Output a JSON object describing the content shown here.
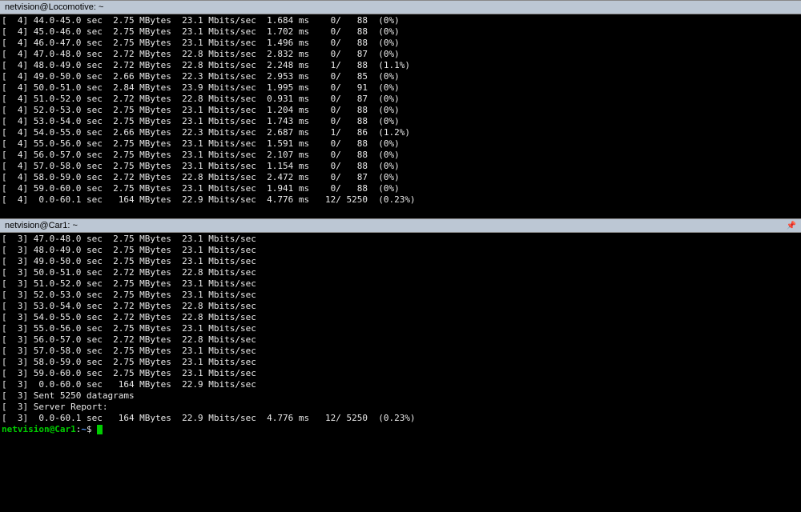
{
  "top": {
    "title": "netvision@Locomotive: ~",
    "rows": [
      [
        "[  4]",
        "44.0-45.0 sec",
        "2.75 MBytes",
        "23.1 Mbits/sec",
        "1.684 ms",
        "0/",
        "88",
        "(0%)"
      ],
      [
        "[  4]",
        "45.0-46.0 sec",
        "2.75 MBytes",
        "23.1 Mbits/sec",
        "1.702 ms",
        "0/",
        "88",
        "(0%)"
      ],
      [
        "[  4]",
        "46.0-47.0 sec",
        "2.75 MBytes",
        "23.1 Mbits/sec",
        "1.496 ms",
        "0/",
        "88",
        "(0%)"
      ],
      [
        "[  4]",
        "47.0-48.0 sec",
        "2.72 MBytes",
        "22.8 Mbits/sec",
        "2.832 ms",
        "0/",
        "87",
        "(0%)"
      ],
      [
        "[  4]",
        "48.0-49.0 sec",
        "2.72 MBytes",
        "22.8 Mbits/sec",
        "2.248 ms",
        "1/",
        "88",
        "(1.1%)"
      ],
      [
        "[  4]",
        "49.0-50.0 sec",
        "2.66 MBytes",
        "22.3 Mbits/sec",
        "2.953 ms",
        "0/",
        "85",
        "(0%)"
      ],
      [
        "[  4]",
        "50.0-51.0 sec",
        "2.84 MBytes",
        "23.9 Mbits/sec",
        "1.995 ms",
        "0/",
        "91",
        "(0%)"
      ],
      [
        "[  4]",
        "51.0-52.0 sec",
        "2.72 MBytes",
        "22.8 Mbits/sec",
        "0.931 ms",
        "0/",
        "87",
        "(0%)"
      ],
      [
        "[  4]",
        "52.0-53.0 sec",
        "2.75 MBytes",
        "23.1 Mbits/sec",
        "1.204 ms",
        "0/",
        "88",
        "(0%)"
      ],
      [
        "[  4]",
        "53.0-54.0 sec",
        "2.75 MBytes",
        "23.1 Mbits/sec",
        "1.743 ms",
        "0/",
        "88",
        "(0%)"
      ],
      [
        "[  4]",
        "54.0-55.0 sec",
        "2.66 MBytes",
        "22.3 Mbits/sec",
        "2.687 ms",
        "1/",
        "86",
        "(1.2%)"
      ],
      [
        "[  4]",
        "55.0-56.0 sec",
        "2.75 MBytes",
        "23.1 Mbits/sec",
        "1.591 ms",
        "0/",
        "88",
        "(0%)"
      ],
      [
        "[  4]",
        "56.0-57.0 sec",
        "2.75 MBytes",
        "23.1 Mbits/sec",
        "2.107 ms",
        "0/",
        "88",
        "(0%)"
      ],
      [
        "[  4]",
        "57.0-58.0 sec",
        "2.75 MBytes",
        "23.1 Mbits/sec",
        "1.154 ms",
        "0/",
        "88",
        "(0%)"
      ],
      [
        "[  4]",
        "58.0-59.0 sec",
        "2.72 MBytes",
        "22.8 Mbits/sec",
        "2.472 ms",
        "0/",
        "87",
        "(0%)"
      ],
      [
        "[  4]",
        "59.0-60.0 sec",
        "2.75 MBytes",
        "23.1 Mbits/sec",
        "1.941 ms",
        "0/",
        "88",
        "(0%)"
      ],
      [
        "[  4]",
        " 0.0-60.1 sec",
        " 164 MBytes",
        "22.9 Mbits/sec",
        "4.776 ms",
        "12/",
        "5250",
        "(0.23%)"
      ]
    ]
  },
  "bottom": {
    "title": "netvision@Car1: ~",
    "rows": [
      [
        "[  3]",
        "47.0-48.0 sec",
        "2.75 MBytes",
        "23.1 Mbits/sec"
      ],
      [
        "[  3]",
        "48.0-49.0 sec",
        "2.75 MBytes",
        "23.1 Mbits/sec"
      ],
      [
        "[  3]",
        "49.0-50.0 sec",
        "2.75 MBytes",
        "23.1 Mbits/sec"
      ],
      [
        "[  3]",
        "50.0-51.0 sec",
        "2.72 MBytes",
        "22.8 Mbits/sec"
      ],
      [
        "[  3]",
        "51.0-52.0 sec",
        "2.75 MBytes",
        "23.1 Mbits/sec"
      ],
      [
        "[  3]",
        "52.0-53.0 sec",
        "2.75 MBytes",
        "23.1 Mbits/sec"
      ],
      [
        "[  3]",
        "53.0-54.0 sec",
        "2.72 MBytes",
        "22.8 Mbits/sec"
      ],
      [
        "[  3]",
        "54.0-55.0 sec",
        "2.72 MBytes",
        "22.8 Mbits/sec"
      ],
      [
        "[  3]",
        "55.0-56.0 sec",
        "2.75 MBytes",
        "23.1 Mbits/sec"
      ],
      [
        "[  3]",
        "56.0-57.0 sec",
        "2.72 MBytes",
        "22.8 Mbits/sec"
      ],
      [
        "[  3]",
        "57.0-58.0 sec",
        "2.75 MBytes",
        "23.1 Mbits/sec"
      ],
      [
        "[  3]",
        "58.0-59.0 sec",
        "2.75 MBytes",
        "23.1 Mbits/sec"
      ],
      [
        "[  3]",
        "59.0-60.0 sec",
        "2.75 MBytes",
        "23.1 Mbits/sec"
      ],
      [
        "[  3]",
        " 0.0-60.0 sec",
        " 164 MBytes",
        "22.9 Mbits/sec"
      ]
    ],
    "sent_line": "[  3] Sent 5250 datagrams",
    "report_line": "[  3] Server Report:",
    "summary": [
      "[  3]",
      " 0.0-60.1 sec",
      " 164 MBytes",
      "22.9 Mbits/sec",
      "4.776 ms",
      "12/",
      "5250",
      "(0.23%)"
    ],
    "prompt_user": "netvision@Car1",
    "prompt_sep": ":",
    "prompt_path": "~",
    "prompt_end": "$"
  }
}
